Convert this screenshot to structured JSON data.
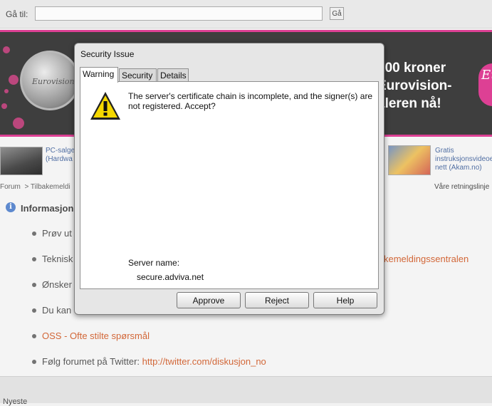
{
  "goto": {
    "label": "Gå til:",
    "value": "",
    "button": "Gå"
  },
  "banner": {
    "text_lines": [
      "100 kroner",
      "Eurovision-",
      "aleren nå!"
    ],
    "medal_text": "Eurovision",
    "logo_text": "Eu",
    "colors": {
      "accent": "#d6167d",
      "background": "#141414"
    }
  },
  "ads": [
    {
      "lines": [
        "PC-salge",
        "(Hardwa"
      ]
    },
    {
      "lines": [
        "Gratis",
        "instruksjonsvideoe",
        "nett (Akam.no)"
      ]
    }
  ],
  "breadcrumb": {
    "home": "Forum",
    "separator": ">",
    "current": "Tilbakemeldi"
  },
  "rules_link": "Våre retningslinje",
  "info": {
    "icon": "info-icon",
    "title": "Informasjon",
    "items": [
      {
        "text": "Prøv ut",
        "link": ""
      },
      {
        "text": "Teknisk",
        "link": "kemeldingssentralen"
      },
      {
        "text": "Ønsker",
        "link": ""
      },
      {
        "text": "Du kan",
        "link": ""
      },
      {
        "text": "",
        "link": "OSS - Ofte stilte spørsmål"
      },
      {
        "text": "Følg forumet på Twitter: ",
        "link": "http://twitter.com/diskusjon_no"
      }
    ]
  },
  "bottom": {
    "text": "Nyeste"
  },
  "dialog": {
    "title": "Security Issue",
    "tabs": [
      {
        "label": "Warning",
        "active": true
      },
      {
        "label": "Security",
        "active": false
      },
      {
        "label": "Details",
        "active": false
      }
    ],
    "warning_icon": "warning-triangle-icon",
    "message": "The server's certificate chain is incomplete, and the signer(s) are not registered. Accept?",
    "server_label": "Server name:",
    "server_value": "secure.adviva.net",
    "buttons": {
      "approve": "Approve",
      "reject": "Reject",
      "help": "Help"
    }
  }
}
